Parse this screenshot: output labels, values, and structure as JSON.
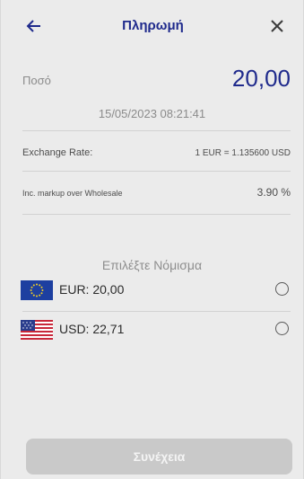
{
  "header": {
    "title": "Πληρωμή"
  },
  "payment": {
    "amount_label": "Ποσό",
    "amount": "20,00",
    "datetime": "15/05/2023 08:21:41"
  },
  "details": [
    {
      "label": "Exchange Rate:",
      "value": "1 EUR = 1.135600 USD"
    },
    {
      "label": "Inc. markup over Wholesale",
      "value": "3.90 %"
    }
  ],
  "currency_select": {
    "title": "Επιλέξτε Νόμισμα",
    "options": [
      {
        "label": "EUR: 20,00",
        "flag_icon": "eu-flag-icon",
        "selected": false
      },
      {
        "label": "USD: 22,71",
        "flag_icon": "us-flag-icon",
        "selected": false
      }
    ]
  },
  "footer": {
    "continue_label": "Συνέχεια"
  },
  "colors": {
    "accent": "#1f2a8c",
    "background": "#ebebeb",
    "button_disabled": "#c9c9c9"
  }
}
